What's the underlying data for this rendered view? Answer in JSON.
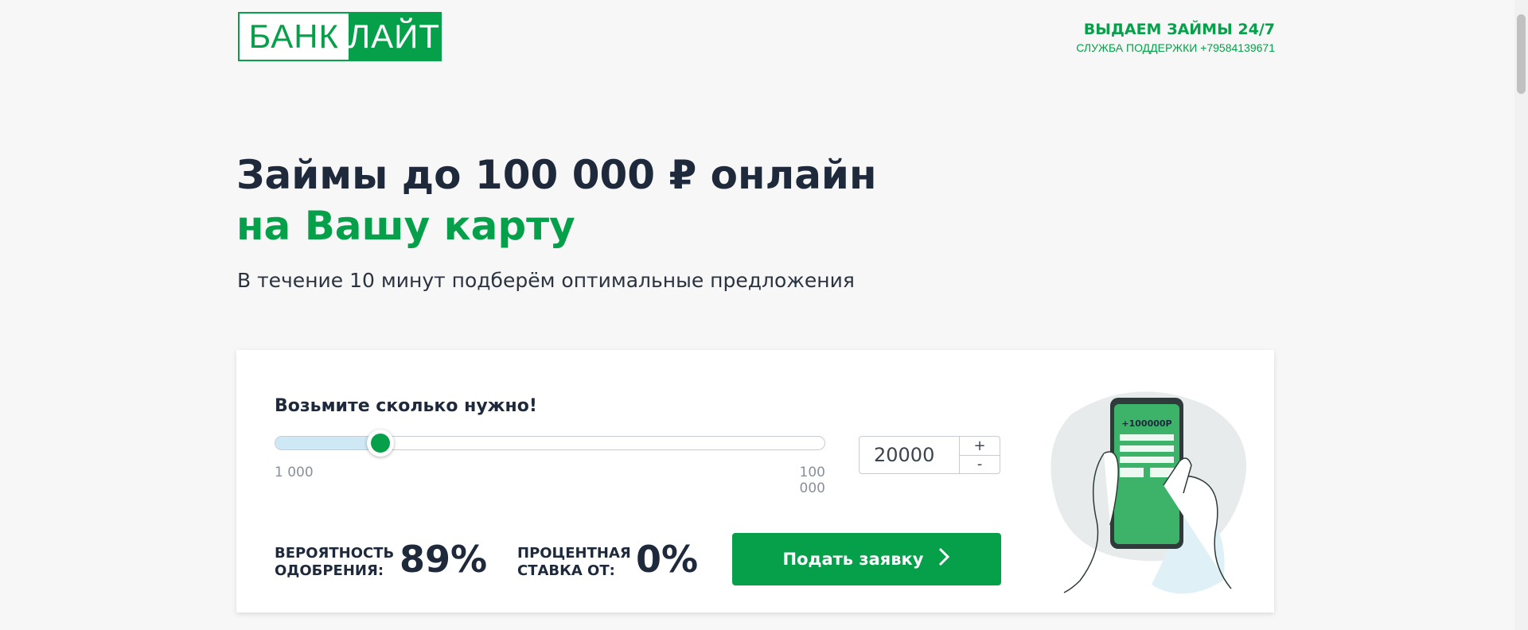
{
  "header": {
    "logo_left": "БАНК",
    "logo_right": "ЛАЙТ",
    "tagline": "ВЫДАЕМ ЗАЙМЫ 24/7",
    "support": "СЛУЖБА ПОДДЕРЖКИ +79584139671"
  },
  "hero": {
    "title_line1": "Займы до 100 000 ₽ онлайн",
    "title_line2": "на Вашу карту",
    "subtitle": "В течение 10 минут подберём оптимальные предложения"
  },
  "calculator": {
    "title": "Возьмите сколько нужно!",
    "min_label": "1 000",
    "max_label": "100 000",
    "min": 1000,
    "max": 100000,
    "value": 20000,
    "value_display": "20000",
    "plus": "+",
    "minus": "-",
    "approval_label_1": "ВЕРОЯТНОСТЬ",
    "approval_label_2": "ОДОБРЕНИЯ:",
    "approval_value": "89%",
    "rate_label_1": "ПРОЦЕНТНАЯ",
    "rate_label_2": "СТАВКА ОТ:",
    "rate_value": "0%",
    "apply_label": "Подать заявку"
  },
  "phone": {
    "amount": "+100000Р"
  },
  "colors": {
    "brand_green": "#07a04a",
    "text_dark": "#1e2a3b",
    "slider_fill": "#cfe8f6"
  }
}
